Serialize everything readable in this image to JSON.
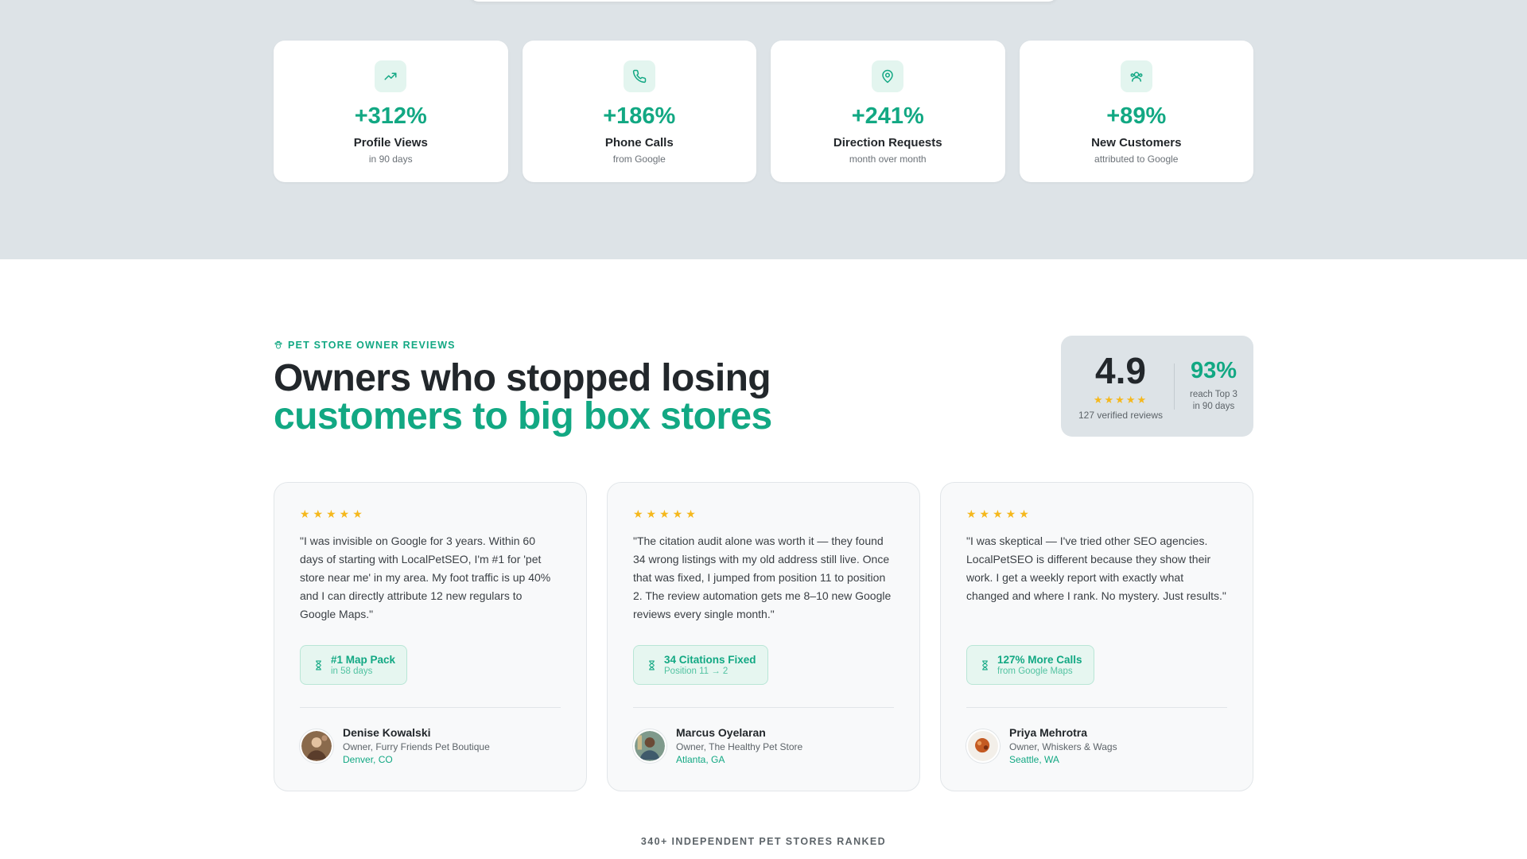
{
  "stats": [
    {
      "icon": "trending-up-icon",
      "value": "+312%",
      "label": "Profile Views",
      "sub": "in 90 days"
    },
    {
      "icon": "phone-icon",
      "value": "+186%",
      "label": "Phone Calls",
      "sub": "from Google"
    },
    {
      "icon": "map-pin-icon",
      "value": "+241%",
      "label": "Direction Requests",
      "sub": "month over month"
    },
    {
      "icon": "users-icon",
      "value": "+89%",
      "label": "New Customers",
      "sub": "attributed to Google"
    }
  ],
  "reviews_section": {
    "eyebrow": "PET STORE OWNER REVIEWS",
    "headline_line1": "Owners who stopped losing",
    "headline_line2": "customers to big box stores",
    "rating": {
      "score": "4.9",
      "stars": "★★★★★",
      "count": "127 verified reviews",
      "pct": "93%",
      "pct_sub": "reach Top 3 in 90 days"
    },
    "reviews": [
      {
        "stars": "★★★★★",
        "quote": "\"I was invisible on Google for 3 years. Within 60 days of starting with LocalPetSEO, I'm #1 for 'pet store near me' in my area. My foot traffic is up 40% and I can directly attribute 12 new regulars to Google Maps.\"",
        "badge_title": "#1 Map Pack",
        "badge_sub": "in 58 days",
        "name": "Denise Kowalski",
        "role": "Owner, Furry Friends Pet Boutique",
        "location": "Denver, CO"
      },
      {
        "stars": "★★★★★",
        "quote": "\"The citation audit alone was worth it — they found 34 wrong listings with my old address still live. Once that was fixed, I jumped from position 11 to position 2. The review automation gets me 8–10 new Google reviews every single month.\"",
        "badge_title": "34 Citations Fixed",
        "badge_sub": "Position 11 → 2",
        "name": "Marcus Oyelaran",
        "role": "Owner, The Healthy Pet Store",
        "location": "Atlanta, GA"
      },
      {
        "stars": "★★★★★",
        "quote": "\"I was skeptical — I've tried other SEO agencies. LocalPetSEO is different because they show their work. I get a weekly report with exactly what changed and where I rank. No mystery. Just results.\"",
        "badge_title": "127% More Calls",
        "badge_sub": "from Google Maps",
        "name": "Priya Mehrotra",
        "role": "Owner, Whiskers & Wags",
        "location": "Seattle, WA"
      }
    ]
  },
  "footer_label": "340+ INDEPENDENT PET STORES RANKED",
  "colors": {
    "accent": "#12a883",
    "star": "#f5b81d",
    "band": "#dde3e7",
    "text": "#22272b"
  }
}
